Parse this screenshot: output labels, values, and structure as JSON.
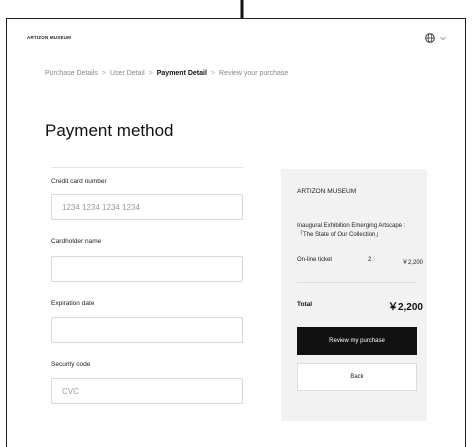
{
  "header": {
    "logo": "ARTIZON MUSEUM",
    "language_icon": "globe-icon"
  },
  "breadcrumb": {
    "items": [
      "Purchase Details",
      "User Detail",
      "Payment Detail",
      "Review your purchase"
    ],
    "active_index": 2,
    "separator": ">"
  },
  "page_title": "Payment method",
  "form": {
    "card_number": {
      "label": "Credit card number",
      "placeholder": "1234 1234 1234 1234",
      "value": ""
    },
    "cardholder": {
      "label": "Cardholder name",
      "placeholder": "",
      "value": ""
    },
    "expiration": {
      "label": "Expiration date",
      "placeholder": "",
      "value": ""
    },
    "security": {
      "label": "Security code",
      "placeholder": "CVC",
      "value": ""
    }
  },
  "summary": {
    "museum": "ARTIZON MUSEUM",
    "exhibition": "Inaugural Exhibition Emerging Artscape : 「The State of Our Collection」",
    "ticket_type": "On-line ticket",
    "quantity": "2",
    "price": "￥2,200",
    "total_label": "Total",
    "total_value": "￥2,200",
    "review_button": "Review my purchase",
    "back_button": "Back"
  },
  "colors": {
    "primary_button": "#111111",
    "summary_bg": "#f2f2f2"
  }
}
